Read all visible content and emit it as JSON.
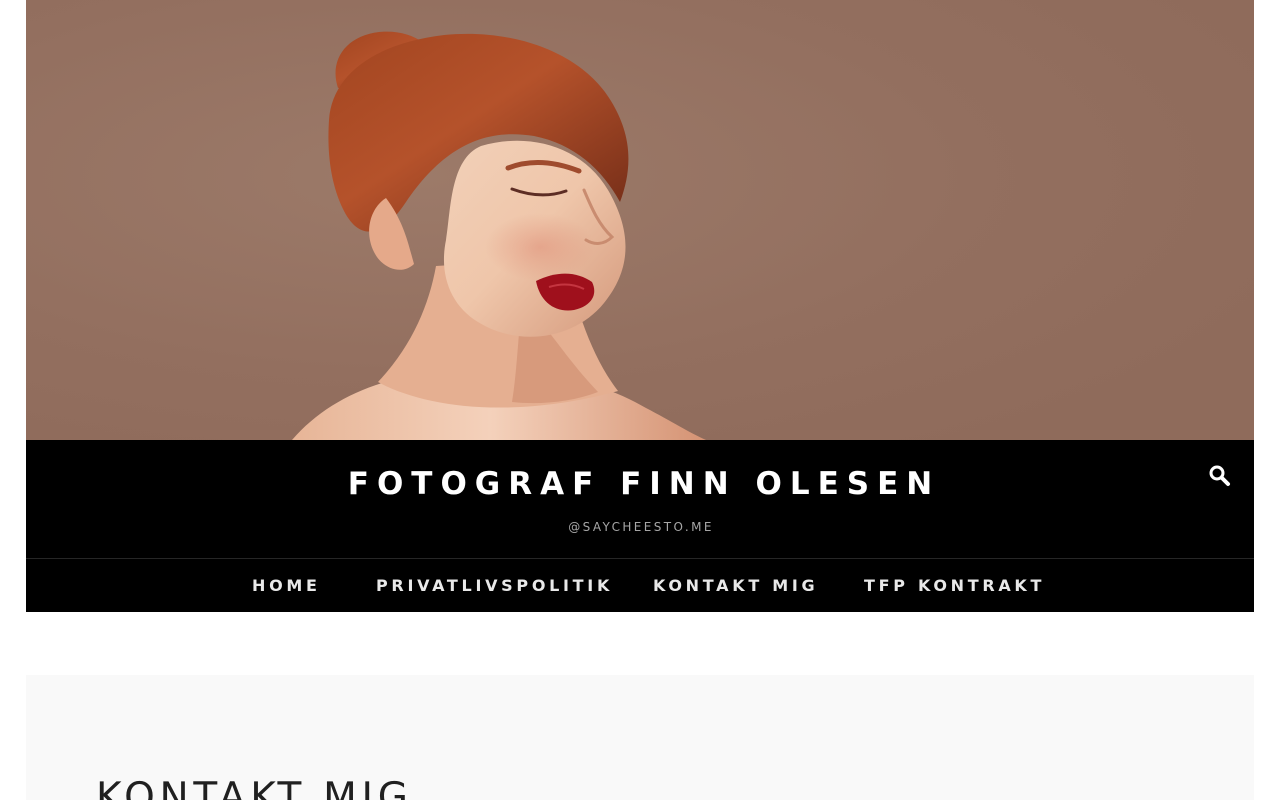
{
  "header": {
    "site_title": "FOTOGRAF FINN OLESEN",
    "tagline": "@SAYCHEESTO.ME"
  },
  "hero": {
    "image_subject": "portrait-photo",
    "background_color": "#957464"
  },
  "navigation": {
    "items": [
      {
        "label": "HOME"
      },
      {
        "label": "PRIVATLIVSPOLITIK"
      },
      {
        "label": "KONTAKT MIG"
      },
      {
        "label": "TFP KONTRAKT"
      }
    ]
  },
  "main": {
    "page_title": "KONTAKT MIG"
  },
  "icons": {
    "search": "search-icon"
  },
  "colors": {
    "header_background": "#000000",
    "title_text": "#ffffff",
    "tagline_text": "#a6a6a6",
    "nav_text": "#e9e9e9",
    "content_background": "#f9f9f9",
    "page_title_text": "#202020"
  }
}
